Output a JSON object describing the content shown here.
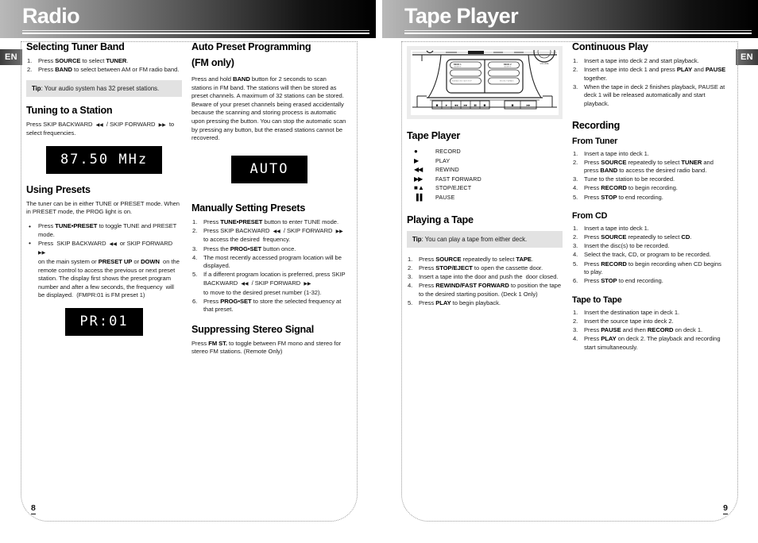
{
  "left_page": {
    "banner_title": "Radio",
    "lang_tab": "EN",
    "page_number": "8",
    "col_a": {
      "selecting_tuner_band": {
        "heading": "Selecting Tuner Band",
        "steps": [
          "Press SOURCE to select TUNER.",
          "Press BAND to select between AM or FM radio band."
        ],
        "tip_label": "Tip",
        "tip_text": ": Your audio system has 32 preset stations."
      },
      "tuning_to_a_station": {
        "heading": "Tuning to a Station",
        "body": "Press SKIP BACKWARD ◀◀ / SKIP FORWARD ▶▶ to select frequencies.",
        "lcd": "87.50 MHz"
      },
      "using_presets": {
        "heading": "Using Presets",
        "body": "The tuner can be in either TUNE or PRESET mode. When in PRESET mode, the PROG light is on.",
        "bullets": [
          "Press TUNE•PRESET to toggle TUNE and PRESET mode.",
          "Press SKIP BACKWARD ◀◀ or SKIP FORWARD ▶▶ on the main system or PRESET UP or DOWN on the remote control to access the previous or next preset station. The display first shows the preset program number and after a few seconds, the frequency will be displayed. (FMPR:01 is FM preset 1)"
        ],
        "lcd": "PR:01"
      }
    },
    "col_b": {
      "auto_preset_programming": {
        "heading": "Auto Preset Programming",
        "subheading": "(FM only)",
        "body": "Press and hold BAND button for 2 seconds to scan stations in FM band. The stations will then be stored as preset channels. A maximum of 32 stations can be stored. Beware of your preset channels being erased accidentally because the scanning and storing process is automatic upon pressing the button. You can stop the automatic scan by pressing any button, but the erased stations cannot be recovered.",
        "lcd": "AUTO"
      },
      "manually_setting_presets": {
        "heading": "Manually Setting Presets",
        "steps": [
          "Press TUNE•PRESET button to enter TUNE mode.",
          "Press SKIP BACKWARD ◀◀ / SKIP FORWARD ▶▶ to access the desired  frequency.",
          "Press the PROG•SET button once.",
          "The most recently accessed program location will be displayed.",
          "If a different program location is preferred, press SKIP BACKWARD ◀◀ / SKIP FORWARD ▶▶ to move to the desired preset number (1-32).",
          "Press PROG•SET to store the selected frequency at that preset."
        ]
      },
      "suppressing_stereo_signal": {
        "heading": "Suppressing Stereo Signal",
        "body": "Press FM ST. to toggle between FM mono and stereo for stereo FM stations. (Remote Only)"
      }
    }
  },
  "right_page": {
    "banner_title": "Tape Player",
    "lang_tab": "EN",
    "page_number": "9",
    "col_a": {
      "device_image_alt": "tape-deck-controls-illustration",
      "tape_player": {
        "heading": "Tape Player",
        "legend": [
          {
            "glyph": "●",
            "label": "RECORD"
          },
          {
            "glyph": "▶",
            "label": "PLAY"
          },
          {
            "glyph": "◀◀",
            "label": "REWIND"
          },
          {
            "glyph": "▶▶",
            "label": "FAST FORWARD"
          },
          {
            "glyph": "■ ▲",
            "label": "STOP/EJECT"
          },
          {
            "glyph": "▐▐",
            "label": "PAUSE"
          }
        ]
      },
      "playing_a_tape": {
        "heading": "Playing a Tape",
        "tip_label": "Tip",
        "tip_text": ": You can play a tape from either deck.",
        "steps": [
          "Press SOURCE repeatedly to select TAPE.",
          "Press STOP/EJECT to open the cassette door.",
          "Insert a tape into the door and push the  door closed.",
          "Press REWIND/FAST FORWARD to position the tape to the desired starting position. (Deck 1 Only)",
          "Press PLAY to begin playback."
        ]
      }
    },
    "col_b": {
      "continuous_play": {
        "heading": "Continuous Play",
        "steps": [
          "Insert a tape into deck 2 and start playback.",
          "Insert a tape into deck 1 and press PLAY and PAUSE together.",
          "When the tape in deck 2 finishes playback, PAUSE at deck 1 will be released automatically and start playback."
        ]
      },
      "recording": {
        "heading": "Recording",
        "from_tuner": {
          "subheading": "From Tuner",
          "steps": [
            "Insert a tape into deck 1.",
            "Press SOURCE repeatedly to select TUNER and press BAND to access the desired radio band.",
            "Tune to the station to be recorded.",
            "Press RECORD to begin recording.",
            "Press STOP to end recording."
          ]
        },
        "from_cd": {
          "subheading": "From CD",
          "steps": [
            "Insert a tape into deck 1.",
            "Press SOURCE repeatedly to select CD.",
            "Insert the disc(s) to be recorded.",
            "Select the track, CD, or program to be recorded.",
            "Press RECORD to begin recording when CD begins to play.",
            "Press STOP to end recording."
          ]
        },
        "tape_to_tape": {
          "subheading": "Tape to Tape",
          "steps": [
            "Insert the destination tape in deck 1.",
            "Insert the source tape into deck 2.",
            "Press PAUSE and then RECORD on deck 1.",
            "Press PLAY on deck 2. The playback and recording start simultaneously."
          ]
        }
      }
    }
  },
  "colors": {
    "banner_start": "#b9b9b9",
    "banner_end": "#000000",
    "tip_bg": "#e2e2e2",
    "lcd_bg": "#000000",
    "lcd_text": "#ffffff",
    "device_bg": "#ececec",
    "dotted_border": "#999999"
  }
}
